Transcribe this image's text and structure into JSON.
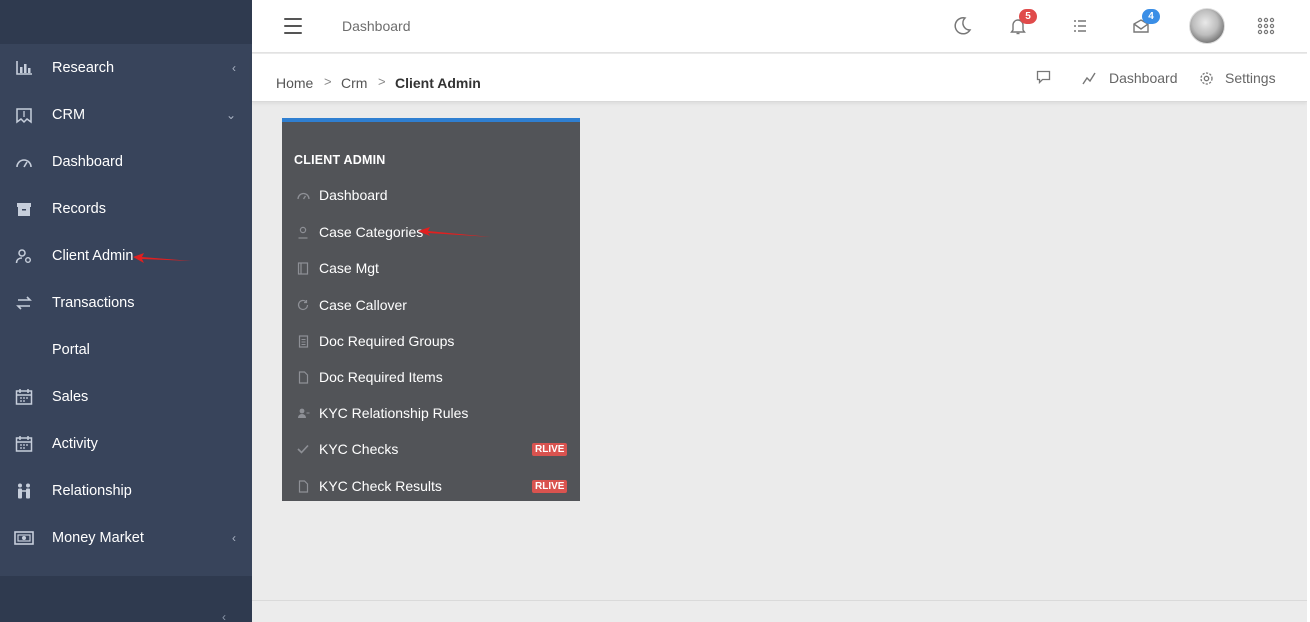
{
  "sidebar": {
    "items": [
      {
        "label": "Research",
        "icon": "bar-chart-icon",
        "chevron": "‹"
      },
      {
        "label": "CRM",
        "icon": "map-icon",
        "chevron": "⌄"
      },
      {
        "label": "Dashboard",
        "icon": "gauge-icon",
        "chevron": ""
      },
      {
        "label": "Records",
        "icon": "archive-box-icon",
        "chevron": ""
      },
      {
        "label": "Client Admin",
        "icon": "user-gear-icon",
        "chevron": ""
      },
      {
        "label": "Transactions",
        "icon": "swap-arrows-icon",
        "chevron": ""
      },
      {
        "label": "Portal",
        "icon": "",
        "chevron": ""
      },
      {
        "label": "Sales",
        "icon": "calendar-icon",
        "chevron": ""
      },
      {
        "label": "Activity",
        "icon": "calendar-icon",
        "chevron": ""
      },
      {
        "label": "Relationship",
        "icon": "people-icon",
        "chevron": ""
      },
      {
        "label": "Money Market",
        "icon": "banknote-icon",
        "chevron": "‹"
      }
    ],
    "collapse_glyph": "‹"
  },
  "topbar": {
    "title": "Dashboard",
    "notifications_count": "5",
    "messages_count": "4"
  },
  "breadcrumb": {
    "home": "Home",
    "sep": ">",
    "crm": "Crm",
    "current": "Client Admin",
    "links": {
      "dashboard": "Dashboard",
      "settings": "Settings"
    }
  },
  "panel": {
    "title": "CLIENT ADMIN",
    "items": [
      {
        "label": "Dashboard",
        "icon": "gauge-icon",
        "badge": ""
      },
      {
        "label": "Case Categories",
        "icon": "user-icon",
        "badge": ""
      },
      {
        "label": "Case Mgt",
        "icon": "book-icon",
        "badge": ""
      },
      {
        "label": "Case Callover",
        "icon": "refresh-icon",
        "badge": ""
      },
      {
        "label": "Doc Required Groups",
        "icon": "document-icon",
        "badge": ""
      },
      {
        "label": "Doc Required Items",
        "icon": "file-icon",
        "badge": ""
      },
      {
        "label": "KYC Relationship Rules",
        "icon": "user-key-icon",
        "badge": ""
      },
      {
        "label": "KYC Checks",
        "icon": "check-icon",
        "badge": "RLIVE"
      },
      {
        "label": "KYC Check Results",
        "icon": "file-icon",
        "badge": "RLIVE"
      }
    ]
  },
  "colors": {
    "sidebar_bg": "#38445b",
    "panel_bg": "#525458",
    "panel_accent": "#2f7fd1",
    "badge_red": "#d9534f",
    "arrow_red": "#e02020"
  }
}
